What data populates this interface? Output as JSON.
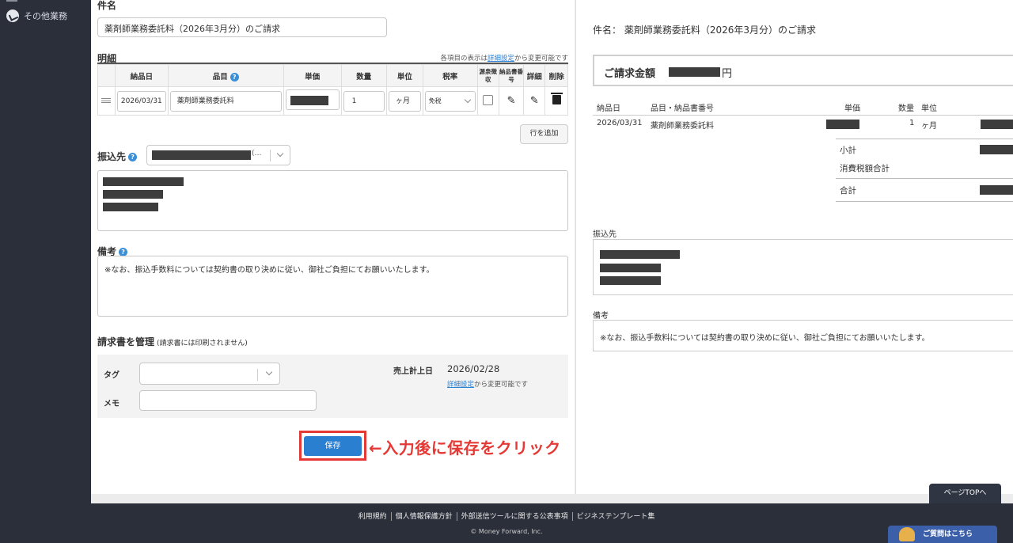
{
  "sidebar": {
    "items": [
      {
        "label": "その他業務",
        "icon": "circle-check-icon"
      }
    ]
  },
  "form": {
    "subject": {
      "label": "件名",
      "value": "薬剤師業務委託料（2026年3月分）のご請求"
    },
    "details": {
      "label": "明細",
      "note_prefix": "各項目の表示は",
      "note_link": "詳細設定",
      "note_suffix": "から変更可能です",
      "columns": [
        "納品日",
        "品目",
        "単価",
        "数量",
        "単位",
        "税率",
        "源泉徴収",
        "納品書番号",
        "詳細",
        "削除"
      ],
      "rows": [
        {
          "date": "2026/03/31",
          "item": "薬剤師業務委託料",
          "quantity": "1",
          "unit": "ヶ月",
          "tax": "免税"
        }
      ],
      "add_row": "行を追加"
    },
    "bank": {
      "label": "振込先",
      "selected_suffix": "(…"
    },
    "remarks": {
      "label": "備考",
      "value": "※なお、振込手数料については契約書の取り決めに従い、御社ご負担にてお願いいたします。"
    },
    "manage": {
      "label": "請求書を管理",
      "note": "(請求書には印刷されません)",
      "tag_label": "タグ",
      "memo_label": "メモ",
      "sales_date_label": "売上計上日",
      "sales_date": "2026/02/28",
      "sales_note_link": "詳細設定",
      "sales_note_suffix": "から変更可能です"
    },
    "save_button": "保存",
    "save_hint": "←入力後に保存をクリック"
  },
  "preview": {
    "subject": "件名：  薬剤師業務委託料（2026年3月分）のご請求",
    "total_label": "ご請求金額",
    "currency": "円",
    "columns": {
      "date": "納品日",
      "item": "品目・納品書番号",
      "price": "単価",
      "qty": "数量",
      "unit": "単位"
    },
    "row": {
      "date": "2026/03/31",
      "item": "薬剤師業務委託料",
      "qty": "1",
      "unit": "ヶ月"
    },
    "subtotal": "小計",
    "tax_total": "消費税額合計",
    "total": "合計",
    "bank_label": "振込先",
    "remarks_label": "備考",
    "remarks": "※なお、振込手数料については契約書の取り決めに従い、御社ご負担にてお願いいたします。"
  },
  "page_top": "ページTOPへ",
  "footer": {
    "links": [
      "利用規約",
      "個人情報保護方針",
      "外部送信ツールに関する公表事項",
      "ビジネステンプレート集"
    ],
    "copyright": "© Money Forward, Inc.",
    "help": "ご質問はこちら"
  }
}
